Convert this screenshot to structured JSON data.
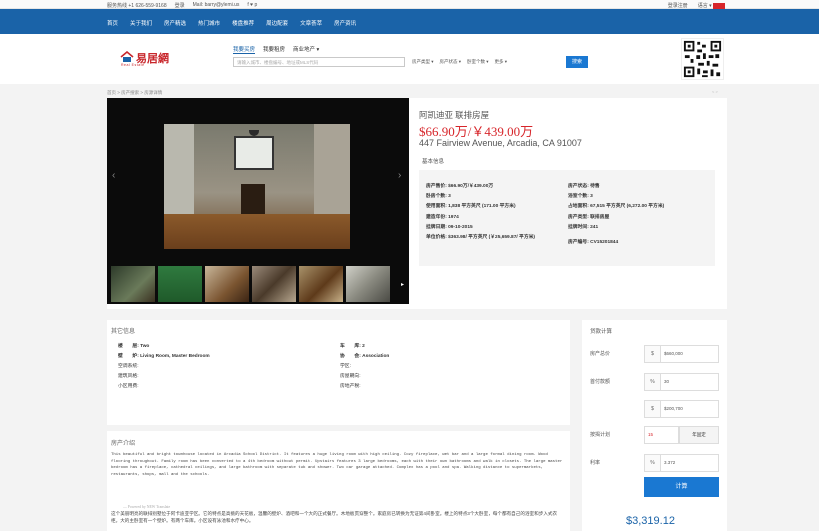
{
  "topbar": {
    "phone": "服务热线 +1 626-559-9168",
    "login": "登录",
    "email": "Mail: barry@ylemi.us",
    "social": "f  ♥  p",
    "register": "登录注册",
    "lang": "语言 ▾"
  },
  "nav": {
    "items": [
      "首页",
      "关于我们",
      "房产精选",
      "热门城市",
      "楼盘推荐",
      "周边配套",
      "文章荟萃",
      "房产资讯"
    ]
  },
  "header": {
    "brand": "易居網",
    "brand_sub": "Real Estate",
    "tabs": [
      "我要买房",
      "我要租房",
      "商业地产 ▾"
    ],
    "search_placeholder": "请输入城市、楼盘编号、地址或MLS代码",
    "filters": [
      "房产类型 ▾",
      "房产状态 ▾",
      "卧室个数 ▾",
      "更多 ▾"
    ],
    "search_button": "搜索"
  },
  "breadcrumb": "首页 > 房产搜索 > 房源详情",
  "pager": "< >",
  "listing": {
    "title": "阿凯迪亚 联排房屋",
    "price": "$66.90万/￥439.00万",
    "address": "447 Fairview Avenue, Arcadia, CA 91007",
    "basic_info_label": "基本信息",
    "info_left": [
      "房产售价: $66.90万/￥439.00万",
      "卧房个数: 3",
      "使用面积: 1,838 平方英尺 (171.00 平方米)",
      "建造年份: 1974",
      "挂牌日期: 09-10-2015"
    ],
    "info_left_wrap": "单位价格: $363.98/ 平方英尺 (￥25,659.87/ 平方米)",
    "info_right": [
      "房产状态: 待售",
      "浴室个数: 3",
      "占地面积: 67,515 平方英尺 (6,272.00 平方米)",
      "房产类型: 联排房屋",
      "挂牌时间: 241"
    ],
    "info_right_last": "房产编号: CV15201844"
  },
  "other": {
    "title": "其它信息",
    "rows": [
      [
        "楼　　层: Two",
        "车　　库: 2"
      ],
      [
        "壁　　炉: Living Room, Master Bedroom",
        "协　　会: Association"
      ],
      [
        "空调系统:",
        "学区:"
      ],
      [
        "建筑风格:",
        "房屋朝向:"
      ],
      [
        "小区用费:",
        "房地产税:"
      ]
    ]
  },
  "description": {
    "title": "房产介绍",
    "english": "This beautiful and bright townhouse located in Arcadia School District. It features a huge living room with high ceiling. Cozy fireplace, wet bar and a large formal dining room. Wood flooring throughout. Family room has been converted to a 4th bedroom without permit. Upstairs features 3 large bedrooms, each with their own bathrooms and walk in closets. The large master bedroom has a fireplace, cathedral ceilings, and large bathroom with separate tub and shower. Two car garage attached. Complex has a pool and spa. Walking distance to supermarkets, restaurants, shops, mall and the schools.",
    "powered": "— Powered by NEW Translate",
    "chinese": "这个美丽明亮的联排别墅位于阿卡迪亚学区。它的特点是高挑的天花板，温馨的壁炉、酒吧和一个大的正式餐厅。木地板贯穿整个。家庭房已转换为无证第4间卧室。楼上的特点3个大卧室，每个都有自己的浴室和步入式衣柜。大的主卧室有一个壁炉。有两个车库。小区设有泳池和水疗中心。"
  },
  "calculator": {
    "title": "贷款计算",
    "price_label": "房产总价",
    "price_unit": "$",
    "price_value": "$660,000",
    "down_label": "首付款额",
    "down_unit": "%",
    "down_value": "30",
    "down_amount_unit": "$",
    "down_amount": "$200,700",
    "term_label": "按揭计划",
    "term_value": "15",
    "term_select": "年固定",
    "rate_label": "利率",
    "rate_unit": "%",
    "rate_value": "3.372",
    "button": "计算",
    "result": "$3,319.12"
  }
}
